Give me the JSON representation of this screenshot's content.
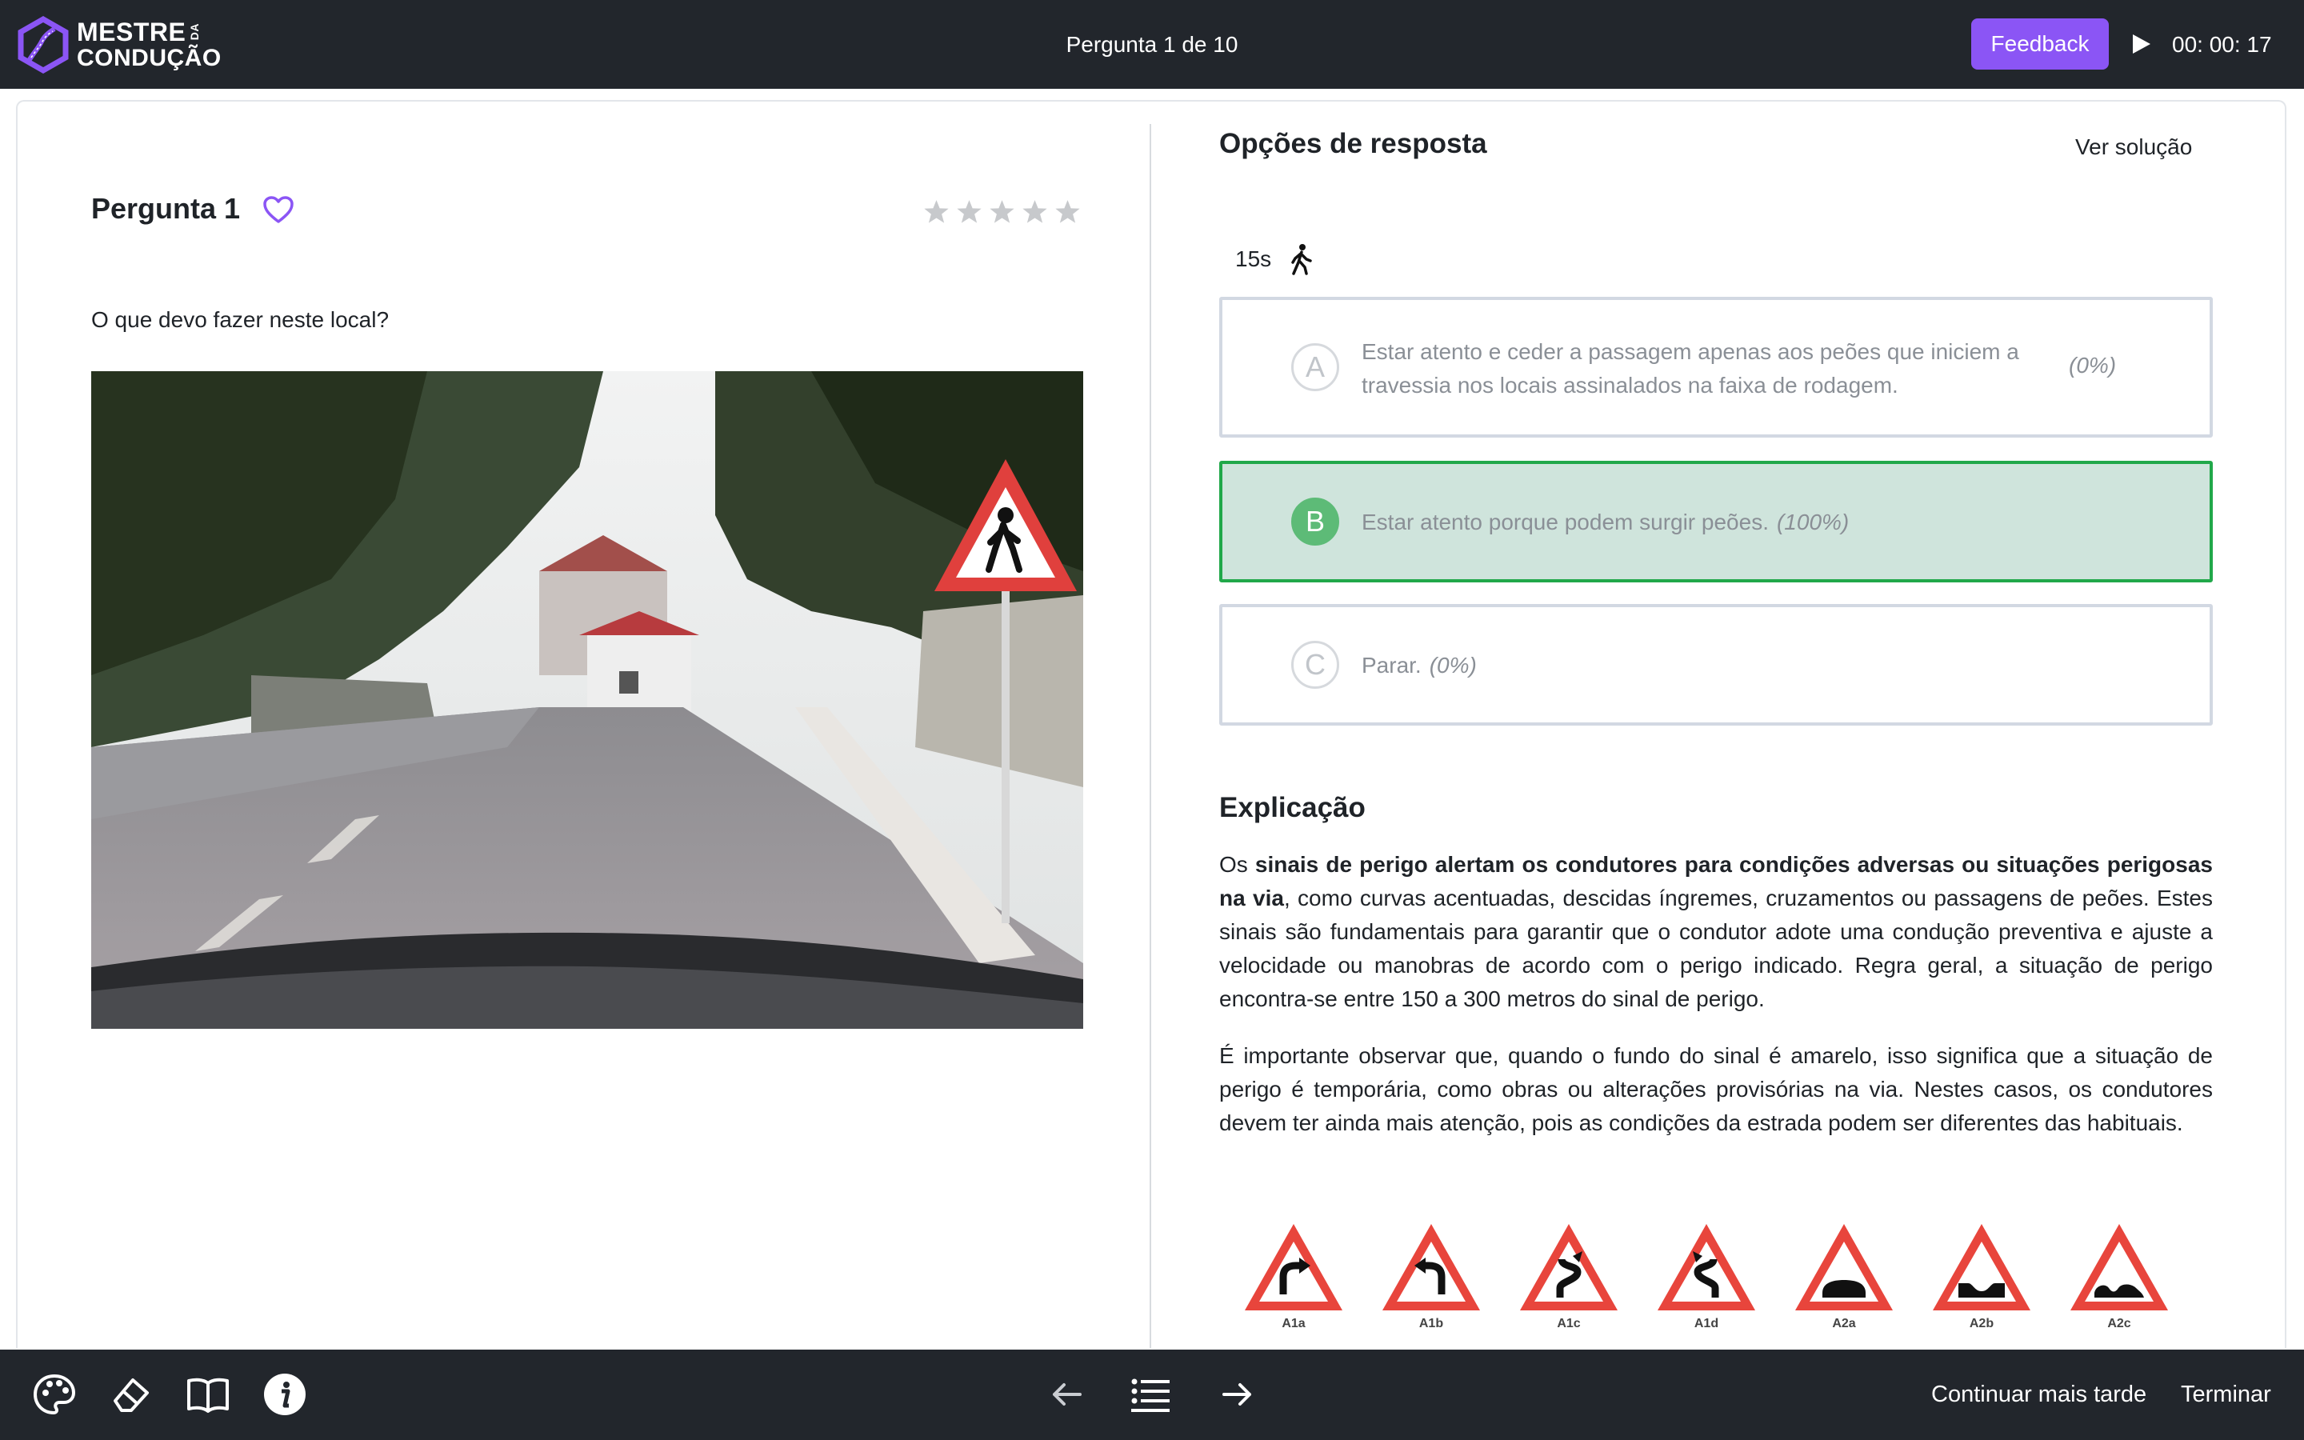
{
  "header": {
    "logo_line1": "MESTRE",
    "logo_da": "DA",
    "logo_line2": "CONDUÇÃO",
    "question_counter": "Pergunta 1 de 10",
    "feedback_label": "Feedback",
    "timer": "00: 00: 17"
  },
  "question": {
    "title": "Pergunta 1",
    "text": "O que devo fazer neste local?",
    "rating": 0,
    "rating_max": 5
  },
  "answers": {
    "section_title": "Opções de resposta",
    "see_solution": "Ver solução",
    "time_label": "15s",
    "options": [
      {
        "letter": "A",
        "text": "Estar atento e ceder a passagem apenas aos peões que iniciem a travessia nos locais assinalados na faixa de rodagem.",
        "percent": "(0%)"
      },
      {
        "letter": "B",
        "text": "Estar atento porque podem surgir peões.",
        "percent": "(100%)"
      },
      {
        "letter": "C",
        "text": "Parar.",
        "percent": "(0%)"
      }
    ]
  },
  "explanation": {
    "title": "Explicação",
    "p1_start": "Os ",
    "p1_bold": "sinais de perigo alertam os condutores para condições adversas ou situações perigosas na via",
    "p1_rest": ", como curvas acentuadas, descidas íngremes, cruzamentos ou passagens de peões. Estes sinais são fundamentais para garantir que o condutor adote uma condução preventiva e ajuste a velocidade ou manobras de acordo com o perigo indicado. Regra geral, a situação de perigo encontra-se entre 150 a 300 metros do sinal de perigo.",
    "p2": "É importante observar que, quando o fundo do sinal é amarelo, isso significa que a situação de perigo é temporária, como obras ou alterações provisórias na via. Nestes casos, os condutores devem ter ainda mais atenção, pois as condições da estrada podem ser diferentes das habituais.",
    "signs": [
      "A1a",
      "A1b",
      "A1c",
      "A1d",
      "A2a",
      "A2b",
      "A2c"
    ]
  },
  "footer": {
    "continue_label": "Continuar mais tarde",
    "finish_label": "Terminar"
  },
  "colors": {
    "accent": "#8b55f5",
    "topbar": "#22262c",
    "correct_bg": "#cfe4dc",
    "correct_border": "#21a84a",
    "sign_red": "#e8453c"
  }
}
